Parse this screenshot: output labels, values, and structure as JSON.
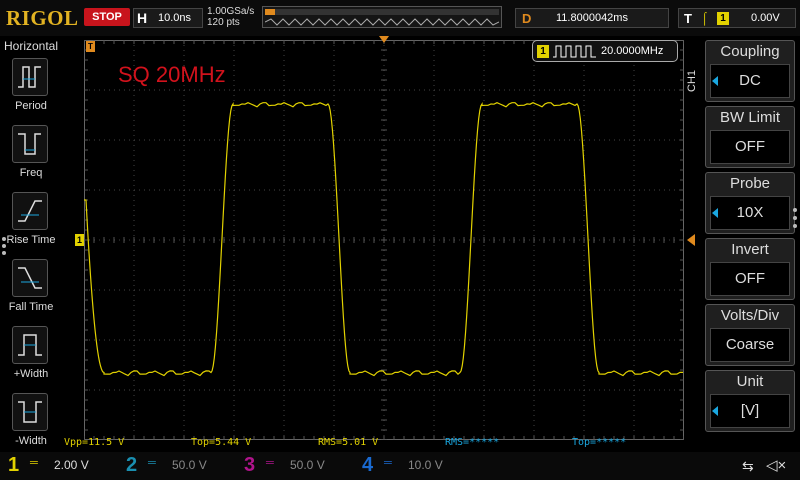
{
  "topbar": {
    "brand": "RIGOL",
    "run_state": "STOP",
    "timebase_key": "H",
    "timebase_value": "10.0ns",
    "sample_rate": "1.00GSa/s",
    "points": "120 pts",
    "delay_key": "D",
    "delay_value": "11.8000042ms",
    "trigger_key": "T",
    "trigger_channel": "1",
    "trigger_level": "0.00V",
    "memory_position_percent": 0
  },
  "left_menu": {
    "title": "Horizontal",
    "items": [
      {
        "label": "Period",
        "icon": "period-icon"
      },
      {
        "label": "Freq",
        "icon": "freq-icon"
      },
      {
        "label": "Rise Time",
        "icon": "rise-time-icon"
      },
      {
        "label": "Fall Time",
        "icon": "fall-time-icon"
      },
      {
        "label": "+Width",
        "icon": "pos-width-icon"
      },
      {
        "label": "-Width",
        "icon": "neg-width-icon"
      }
    ]
  },
  "screen": {
    "annotation": "SQ 20MHz",
    "trigger_marker": "T",
    "channel_marker": "1",
    "freq_counter": {
      "channel": "1",
      "value": "20.0000MHz"
    }
  },
  "right_menu": {
    "channel_label": "CH1",
    "items": [
      {
        "title": "Coupling",
        "value": "DC",
        "arrow": true
      },
      {
        "title": "BW Limit",
        "value": "OFF",
        "arrow": false
      },
      {
        "title": "Probe",
        "value": "10X",
        "arrow": true
      },
      {
        "title": "Invert",
        "value": "OFF",
        "arrow": false
      },
      {
        "title": "Volts/Div",
        "value": "Coarse",
        "arrow": false
      },
      {
        "title": "Unit",
        "value": "[V]",
        "arrow": true
      }
    ]
  },
  "measurements": [
    {
      "text": "Vpp=11.5 V",
      "color": "yellow"
    },
    {
      "text": "Top=5.44 V",
      "color": "yellow"
    },
    {
      "text": "RMS=5.01 V",
      "color": "yellow"
    },
    {
      "text": "RMS=*****",
      "color": "cyan"
    },
    {
      "text": "Top=*****",
      "color": "cyan"
    }
  ],
  "bottom_channels": [
    {
      "num": "1",
      "scale": "2.00 V",
      "color": "#e2d200",
      "active": true
    },
    {
      "num": "2",
      "scale": "50.0 V",
      "color": "#1a8fb0",
      "active": false
    },
    {
      "num": "3",
      "scale": "50.0 V",
      "color": "#b0148c",
      "active": false
    },
    {
      "num": "4",
      "scale": "10.0 V",
      "color": "#1a6ad0",
      "active": false
    }
  ],
  "colors": {
    "ch1": "#e2d200",
    "trigger": "#e08a1e",
    "accent_blue": "#1aa7e0",
    "stop": "#c8141c",
    "annotation": "#d2121c"
  },
  "waveform": {
    "channel": "1",
    "shape": "square",
    "cycles_visible": 2,
    "volts_per_div": 2.0,
    "high_level_v": 5.44,
    "low_level_v": -5.3
  }
}
